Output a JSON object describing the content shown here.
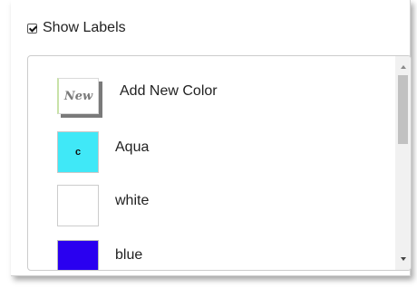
{
  "show_labels": {
    "label": "Show Labels",
    "checked": true
  },
  "colors": [
    {
      "label": "Add New Color",
      "swatch_text": "New",
      "swatch_color": "#ffffff"
    },
    {
      "label": "Aqua",
      "swatch_text": "c",
      "swatch_color": "#40e8f7"
    },
    {
      "label": "white",
      "swatch_text": "",
      "swatch_color": "#ffffff"
    },
    {
      "label": "blue",
      "swatch_text": "",
      "swatch_color": "#2a00f0"
    }
  ],
  "scrollbar": {
    "position_fraction": 0.0
  }
}
